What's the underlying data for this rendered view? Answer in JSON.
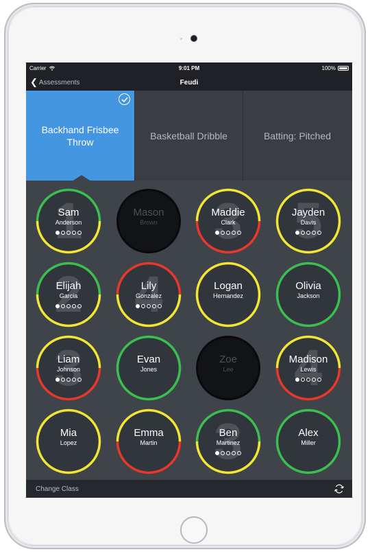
{
  "status_bar": {
    "carrier": "Carrier",
    "wifi_icon": "wifi-icon",
    "time": "9:01 PM",
    "battery": "100%"
  },
  "nav": {
    "back_label": "Assessments",
    "title": "Feudi"
  },
  "tabs": [
    {
      "label": "Backhand Frisbee Throw",
      "selected": true
    },
    {
      "label": "Basketball Dribble",
      "selected": false
    },
    {
      "label": "Batting: Pitched",
      "selected": false
    }
  ],
  "colors": {
    "selected_tab": "#4596e0",
    "green": "#3bbf4f",
    "yellow": "#f2e533",
    "red": "#e8372c"
  },
  "students": [
    {
      "first": "Sam",
      "last": "Anderson",
      "number": "1",
      "ring": [
        "green",
        "yellow"
      ],
      "absent": false,
      "dots": 1
    },
    {
      "first": "Mason",
      "last": "Brown",
      "number": "",
      "ring": [],
      "absent": true,
      "dots": 0
    },
    {
      "first": "Maddie",
      "last": "Clark",
      "number": "3",
      "ring": [
        "yellow",
        "red"
      ],
      "absent": false,
      "dots": 1
    },
    {
      "first": "Jayden",
      "last": "Davis",
      "number": "5",
      "ring": [
        "yellow",
        "yellow"
      ],
      "absent": false,
      "dots": 1
    },
    {
      "first": "Elijah",
      "last": "Garcia",
      "number": "2",
      "ring": [
        "green",
        "yellow"
      ],
      "absent": false,
      "dots": 1
    },
    {
      "first": "Lily",
      "last": "Gonzalez",
      "number": "4",
      "ring": [
        "red",
        "yellow"
      ],
      "absent": false,
      "dots": 1
    },
    {
      "first": "Logan",
      "last": "Hernandez",
      "number": "",
      "ring": [
        "yellow",
        "yellow"
      ],
      "absent": false,
      "dots": 0
    },
    {
      "first": "Olivia",
      "last": "Jackson",
      "number": "",
      "ring": [
        "green",
        "green"
      ],
      "absent": false,
      "dots": 0
    },
    {
      "first": "Liam",
      "last": "Johnson",
      "number": "3",
      "ring": [
        "yellow",
        "red"
      ],
      "absent": false,
      "dots": 1
    },
    {
      "first": "Evan",
      "last": "Jones",
      "number": "",
      "ring": [
        "green",
        "green"
      ],
      "absent": false,
      "dots": 0
    },
    {
      "first": "Zoe",
      "last": "Lee",
      "number": "",
      "ring": [],
      "absent": true,
      "dots": 0
    },
    {
      "first": "Madison",
      "last": "Lewis",
      "number": "4",
      "ring": [
        "yellow",
        "red"
      ],
      "absent": false,
      "dots": 1
    },
    {
      "first": "Mia",
      "last": "Lopez",
      "number": "",
      "ring": [
        "yellow",
        "yellow"
      ],
      "absent": false,
      "dots": 0
    },
    {
      "first": "Emma",
      "last": "Martin",
      "number": "",
      "ring": [
        "yellow",
        "red"
      ],
      "absent": false,
      "dots": 0
    },
    {
      "first": "Ben",
      "last": "Martinez",
      "number": "3",
      "ring": [
        "green",
        "yellow"
      ],
      "absent": false,
      "dots": 1
    },
    {
      "first": "Alex",
      "last": "Miller",
      "number": "",
      "ring": [
        "green",
        "green"
      ],
      "absent": false,
      "dots": 0
    }
  ],
  "bottom_bar": {
    "change_class_label": "Change Class",
    "sync_icon": "sync-icon"
  }
}
